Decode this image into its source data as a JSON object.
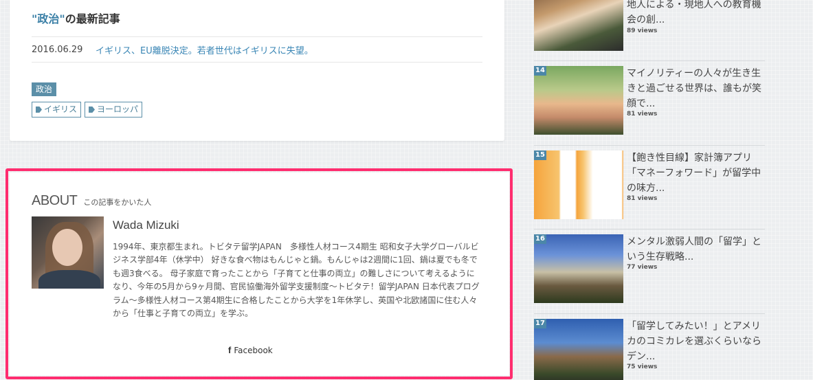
{
  "latest": {
    "keyword": "\"政治\"",
    "title_suffix": "の最新記事",
    "items": [
      {
        "date": "2016.06.29",
        "title": "イギリス、EU離脱決定。若者世代はイギリスに失望。"
      }
    ],
    "category": "政治",
    "tags": [
      "イギリス",
      "ヨーロッパ"
    ]
  },
  "about": {
    "heading": "ABOUT",
    "subheading": "この記事をかいた人",
    "author_name": "Wada Mizuki",
    "bio": "1994年、東京都生まれ。トビタテ留学JAPAN　多様性人材コース4期生 昭和女子大学グローバルビジネス学部4年（休学中） 好きな食べ物はもんじゃと鍋。もんじゃは2週間に1回、鍋は夏でも冬でも週3食べる。 母子家庭で育ったことから「子育てと仕事の両立」の難しさについて考えるようになり、今年の5月から9ヶ月間、官民協働海外留学支援制度〜トビタテ！留学JAPAN 日本代表プログラム〜多様性人材コース第4期生に合格したことから大学を1年休学し、英国や北欧諸国に住む人々から「仕事と子育ての両立」を学ぶ。",
    "facebook_label": "Facebook"
  },
  "ranking": [
    {
      "num": "",
      "title": "地人による・現地人への教育機会の創...",
      "views": "89 views"
    },
    {
      "num": "14",
      "title": "マイノリティーの人々が生き生きと過ごせる世界は、誰もが笑顔で...",
      "views": "81 views"
    },
    {
      "num": "15",
      "title": "【飽き性目線】家計簿アプリ「マネーフォワード」が留学中の味方...",
      "views": "81 views"
    },
    {
      "num": "16",
      "title": "メンタル激弱人間の「留学」という生存戦略...",
      "views": "77 views"
    },
    {
      "num": "17",
      "title": "「留学してみたい！」とアメリカのコミカレを選ぶくらいならデン...",
      "views": "75 views"
    }
  ],
  "colors": {
    "accent": "#3a7fa6",
    "highlight_border": "#ff2d6f",
    "rank_badge": "#4b87a8"
  }
}
